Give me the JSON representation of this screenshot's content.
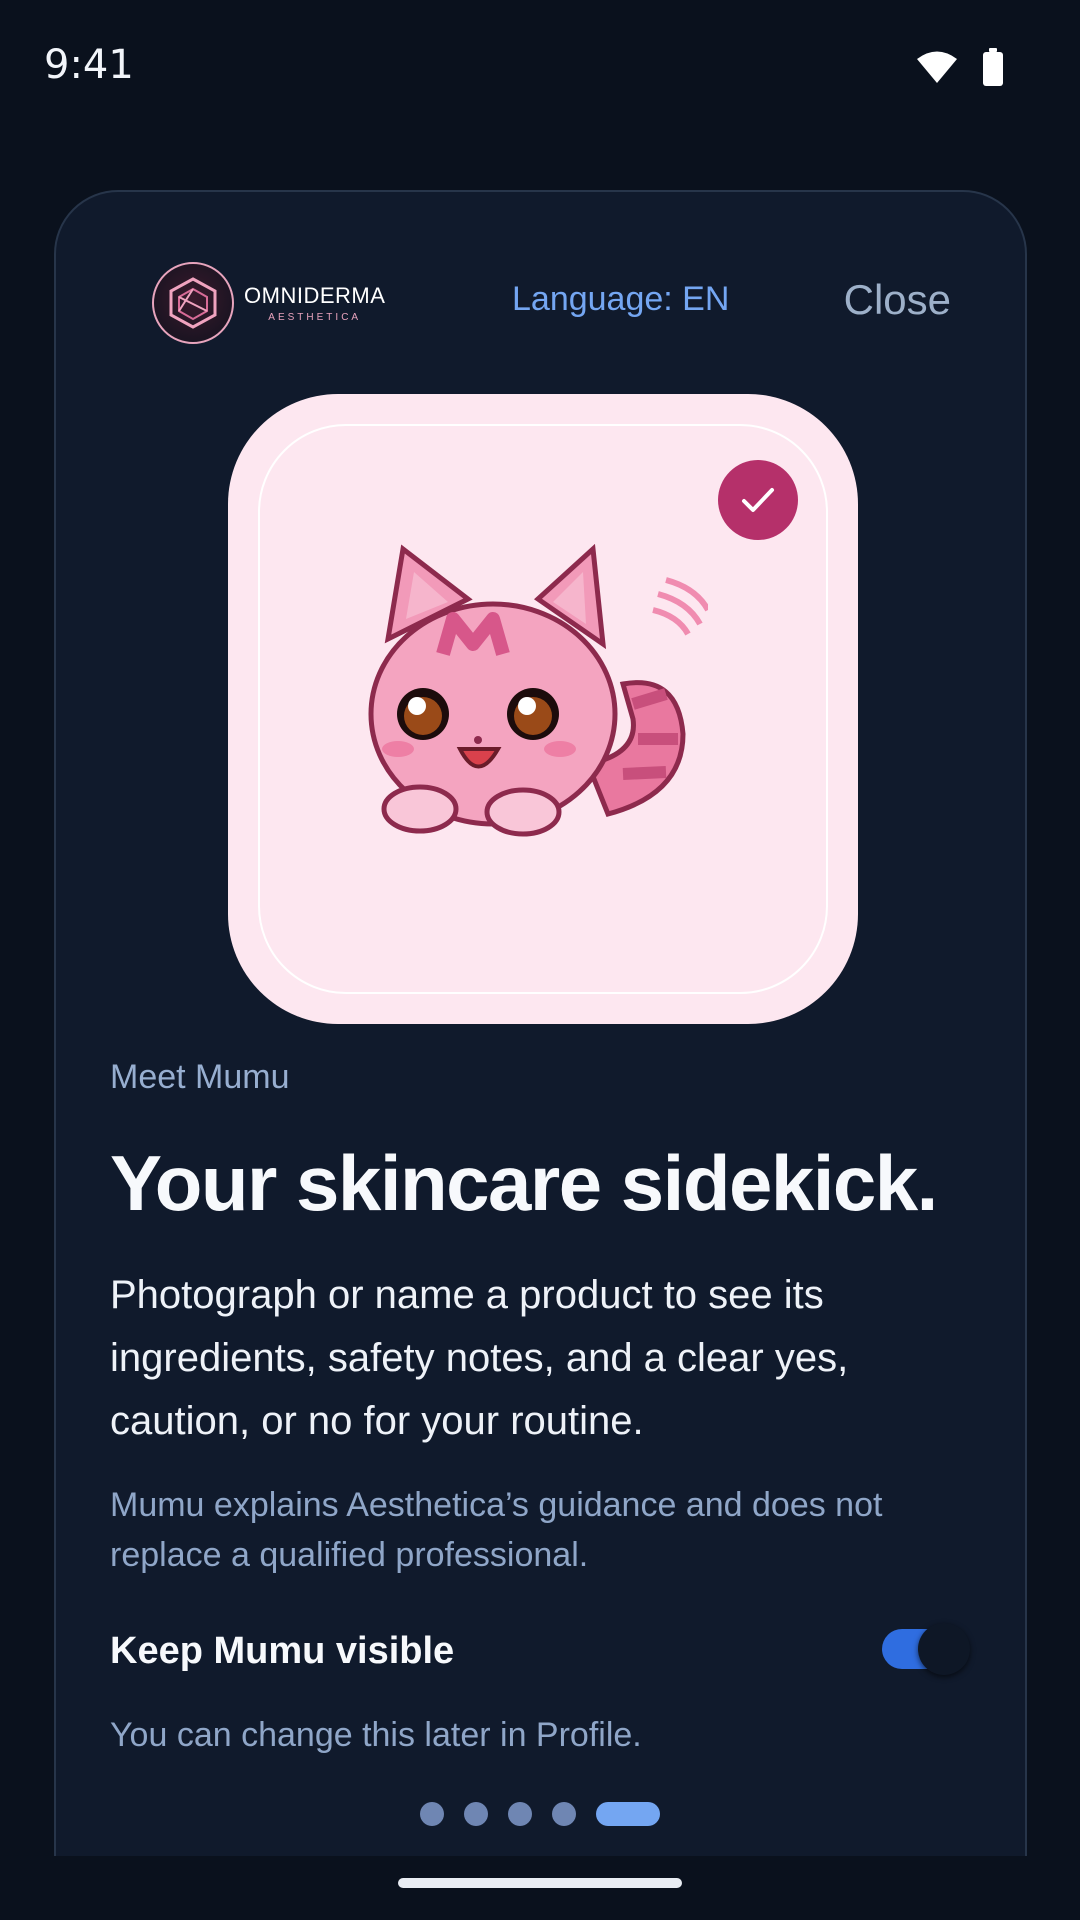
{
  "status_bar": {
    "time": "9:41",
    "icons": [
      "wifi-icon",
      "battery-icon"
    ]
  },
  "header": {
    "logo": {
      "name": "OMNIDERMA",
      "subtitle": "AESTHETICA"
    },
    "language_label": "Language: EN",
    "close_label": "Close"
  },
  "mascot": {
    "badge_icon": "check-icon",
    "illustration": "pink-cat-mascot"
  },
  "content": {
    "eyebrow": "Meet Mumu",
    "headline": "Your skincare sidekick.",
    "body": "Photograph or name a product to see its ingredients, safety notes, and a clear yes, caution, or no for your routine.",
    "disclaimer": "Mumu explains Aesthetica’s guidance and does not replace a qualified professional."
  },
  "visibility_toggle": {
    "label": "Keep Mumu visible",
    "enabled": true,
    "hint": "You can change this later in Profile."
  },
  "pager": {
    "total": 5,
    "current": 5
  },
  "colors": {
    "background": "#0a111d",
    "card": "#101a2c",
    "accent": "#74a6f2",
    "toggle_on": "#2f6de0",
    "badge": "#b5306a",
    "mascot_bg": "#fde7f0"
  }
}
